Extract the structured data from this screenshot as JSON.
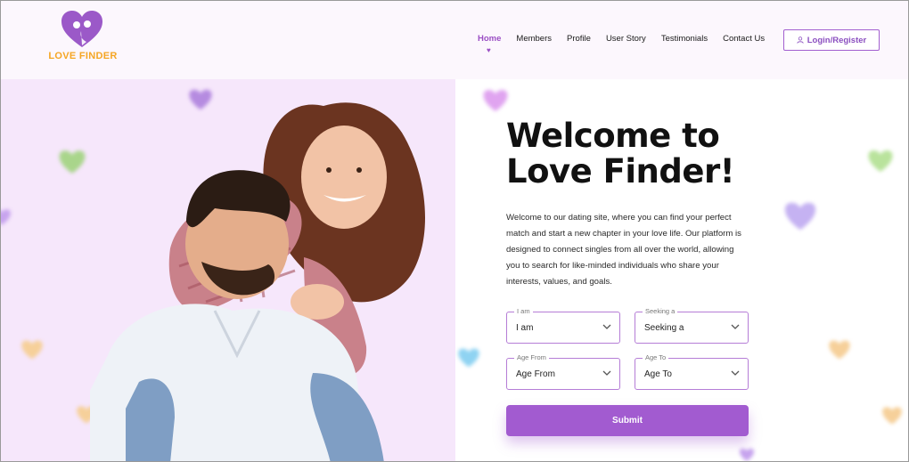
{
  "brand": {
    "name": "LOVE FINDER",
    "logo_color": "#9b59c8",
    "text_color": "#f5a623"
  },
  "nav": {
    "items": [
      {
        "label": "Home",
        "active": true
      },
      {
        "label": "Members",
        "active": false
      },
      {
        "label": "Profile",
        "active": false
      },
      {
        "label": "User Story",
        "active": false
      },
      {
        "label": "Testimonials",
        "active": false
      },
      {
        "label": "Contact Us",
        "active": false
      }
    ],
    "active_indicator": "♥",
    "login_label": "Login/Register",
    "login_icon": "user-icon"
  },
  "hero": {
    "title_line1": "Welcome to",
    "title_line2": "Love Finder!",
    "description": "Welcome to our dating site, where you can find your perfect match and start a new chapter in your love life. Our platform is designed to connect singles from all over the world, allowing you to search for like-minded individuals who share your interests, values, and goals."
  },
  "form": {
    "iam": {
      "label": "I am",
      "value": "I am"
    },
    "seeking": {
      "label": "Seeking a",
      "value": "Seeking a"
    },
    "age_from": {
      "label": "Age From",
      "value": "Age From"
    },
    "age_to": {
      "label": "Age To",
      "value": "Age To"
    },
    "submit_label": "Submit"
  },
  "colors": {
    "accent": "#a25bd0",
    "hero_bg": "#f6e7fb",
    "header_bg": "#fcf7fd"
  }
}
